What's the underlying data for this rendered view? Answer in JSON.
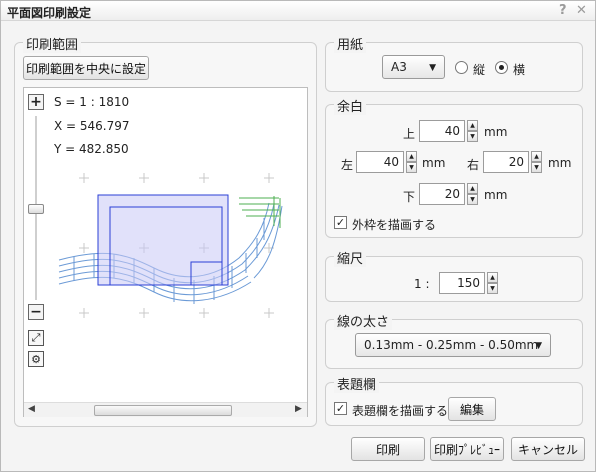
{
  "window": {
    "title": "平面図印刷設定",
    "help_glyph": "?",
    "close_glyph": "✕"
  },
  "print_range": {
    "legend": "印刷範囲",
    "center_button": "印刷範囲を中央に設定",
    "scale_readout": "S = 1 : 1810",
    "x_readout": "X = 546.797",
    "y_readout": "Y = 482.850",
    "zoom_in": "+",
    "zoom_out": "−",
    "scroll_left": "◀",
    "scroll_right": "▶"
  },
  "paper": {
    "legend": "用紙",
    "size": "A3",
    "portrait_label": "縦",
    "landscape_label": "横",
    "orientation": "landscape"
  },
  "margin": {
    "legend": "余白",
    "top_label": "上",
    "top_value": "40",
    "left_label": "左",
    "left_value": "40",
    "right_label": "右",
    "right_value": "20",
    "bottom_label": "下",
    "bottom_value": "20",
    "unit": "mm",
    "outer_frame_label": "外枠を描画する",
    "outer_frame_checked": true
  },
  "scale": {
    "legend": "縮尺",
    "prefix": "1 :",
    "value": "150"
  },
  "line_width": {
    "legend": "線の太さ",
    "value": "0.13mm - 0.25mm - 0.50mm"
  },
  "title_block": {
    "legend": "表題欄",
    "draw_label": "表題欄を描画する",
    "checked": true,
    "edit_button": "編集"
  },
  "footer": {
    "print": "印刷",
    "preview": "印刷ﾌﾟﾚﾋﾞｭｰ",
    "cancel": "キャンセル"
  },
  "colors": {
    "accent_blue": "#2a3fd6",
    "frame_fill": "#c9c9f5",
    "road": "#6b9ad6",
    "road_green": "#4caf50"
  }
}
